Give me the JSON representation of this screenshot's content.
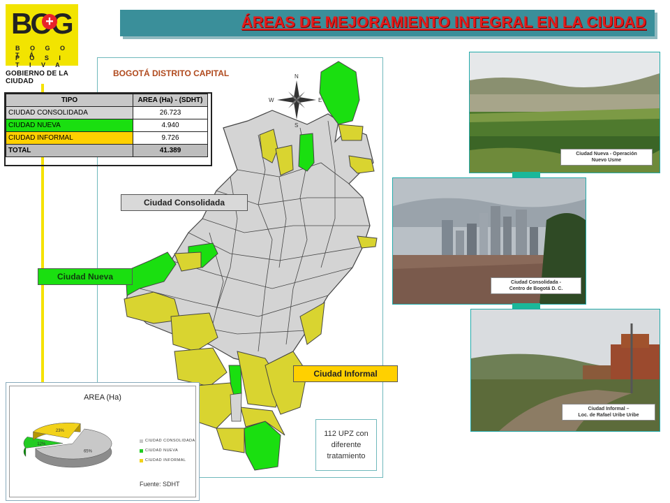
{
  "logo": {
    "word": "BOG",
    "plus": "+",
    "line1": "B O G O T Á",
    "line2": "P O S I T I V A",
    "government": "GOBIERNO DE LA CIUDAD"
  },
  "header": {
    "title": "ÁREAS DE MEJORAMIENTO INTEGRAL EN LA CIUDAD"
  },
  "map": {
    "title": "BOGOTÁ DISTRITO CAPITAL",
    "compass": {
      "n": "N",
      "s": "S",
      "e": "E",
      "w": "W"
    },
    "labels": {
      "consolidada": "Ciudad Consolidada",
      "nueva": "Ciudad Nueva",
      "informal": "Ciudad Informal"
    },
    "upz_note": [
      "112 UPZ con",
      "diferente",
      "tratamiento"
    ]
  },
  "table": {
    "headers": [
      "TIPO",
      "AREA (Ha) - (SDHT)"
    ],
    "rows": [
      {
        "tipo": "CIUDAD CONSOLIDADA",
        "area": "26.723"
      },
      {
        "tipo": "CIUDAD NUEVA",
        "area": "4.940"
      },
      {
        "tipo": "CIUDAD INFORMAL",
        "area": "9.726"
      },
      {
        "tipo": "TOTAL",
        "area": "41.389"
      }
    ]
  },
  "chart_data": {
    "type": "pie",
    "title": "AREA (Ha)",
    "categories": [
      "CIUDAD CONSOLIDADA",
      "CIUDAD NUEVA",
      "CIUDAD INFORMAL"
    ],
    "values": [
      65,
      12,
      23
    ],
    "value_labels": [
      "65%",
      "12%",
      "23%"
    ],
    "colors": [
      "#c8c8c8",
      "#22cc22",
      "#f2d21a"
    ],
    "legend_position": "right",
    "source": "Fuente: SDHT"
  },
  "photos": [
    {
      "caption_line1": "Ciudad Nueva - Operación",
      "caption_line2": "Nuevo Usme"
    },
    {
      "caption_line1": "Ciudad Consolidada -",
      "caption_line2": "Centro de Bogotá D. C."
    },
    {
      "caption_line1": "Ciudad Informal –",
      "caption_line2": "Loc. de Rafael Uribe Uribe"
    }
  ],
  "colors": {
    "banner": "#3a8f9a",
    "title": "#e31b1b",
    "consolidada": "#d4d4d4",
    "nueva": "#1adf10",
    "informal": "#d9d430"
  }
}
